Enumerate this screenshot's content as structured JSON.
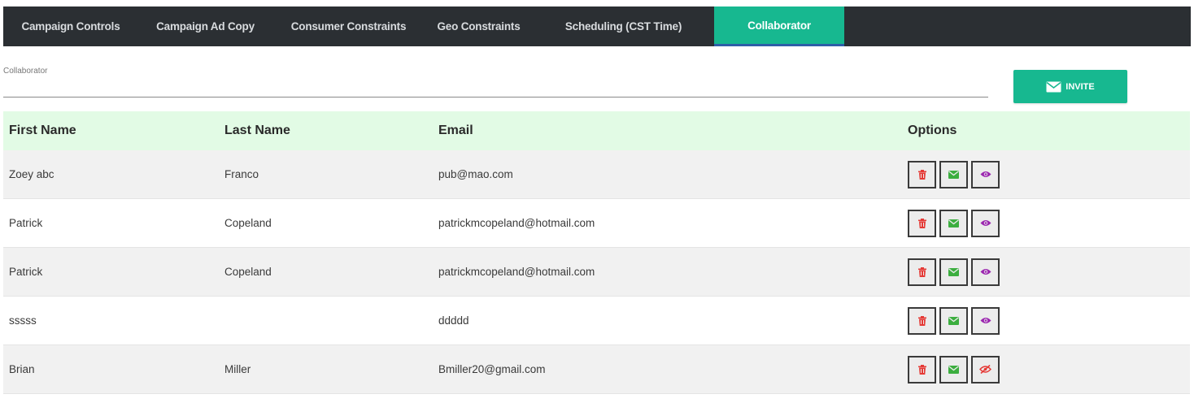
{
  "tabs": [
    {
      "label": "Campaign Controls",
      "active": false
    },
    {
      "label": "Campaign Ad Copy",
      "active": false
    },
    {
      "label": "Consumer Constraints",
      "active": false
    },
    {
      "label": "Geo Constraints",
      "active": false
    },
    {
      "label": "Scheduling (CST Time)",
      "active": false
    },
    {
      "label": "Collaborator",
      "active": true
    }
  ],
  "collaborator_field": {
    "label": "Collaborator",
    "value": ""
  },
  "invite_button": {
    "label": "INVITE",
    "icon": "envelope-icon"
  },
  "table": {
    "headers": {
      "first_name": "First Name",
      "last_name": "Last Name",
      "email": "Email",
      "options": "Options"
    },
    "rows": [
      {
        "first_name": "Zoey abc",
        "last_name": "Franco",
        "email": "pub@mao.com",
        "visibility_icon": "eye-icon"
      },
      {
        "first_name": "Patrick",
        "last_name": "Copeland",
        "email": "patrickmcopeland@hotmail.com",
        "visibility_icon": "eye-icon"
      },
      {
        "first_name": "Patrick",
        "last_name": "Copeland",
        "email": "patrickmcopeland@hotmail.com",
        "visibility_icon": "eye-icon"
      },
      {
        "first_name": "sssss",
        "last_name": "",
        "email": "ddddd",
        "visibility_icon": "eye-icon"
      },
      {
        "first_name": "Brian",
        "last_name": "Miller",
        "email": "Bmiller20@gmail.com",
        "visibility_icon": "eye-slash-icon"
      }
    ]
  },
  "colors": {
    "tabbar_bg": "#2b2f33",
    "accent": "#17b890",
    "header_bg": "#e2fbe5",
    "delete": "#e53935",
    "email": "#3cae3f",
    "view": "#9c27b0",
    "hidden": "#e53935"
  }
}
